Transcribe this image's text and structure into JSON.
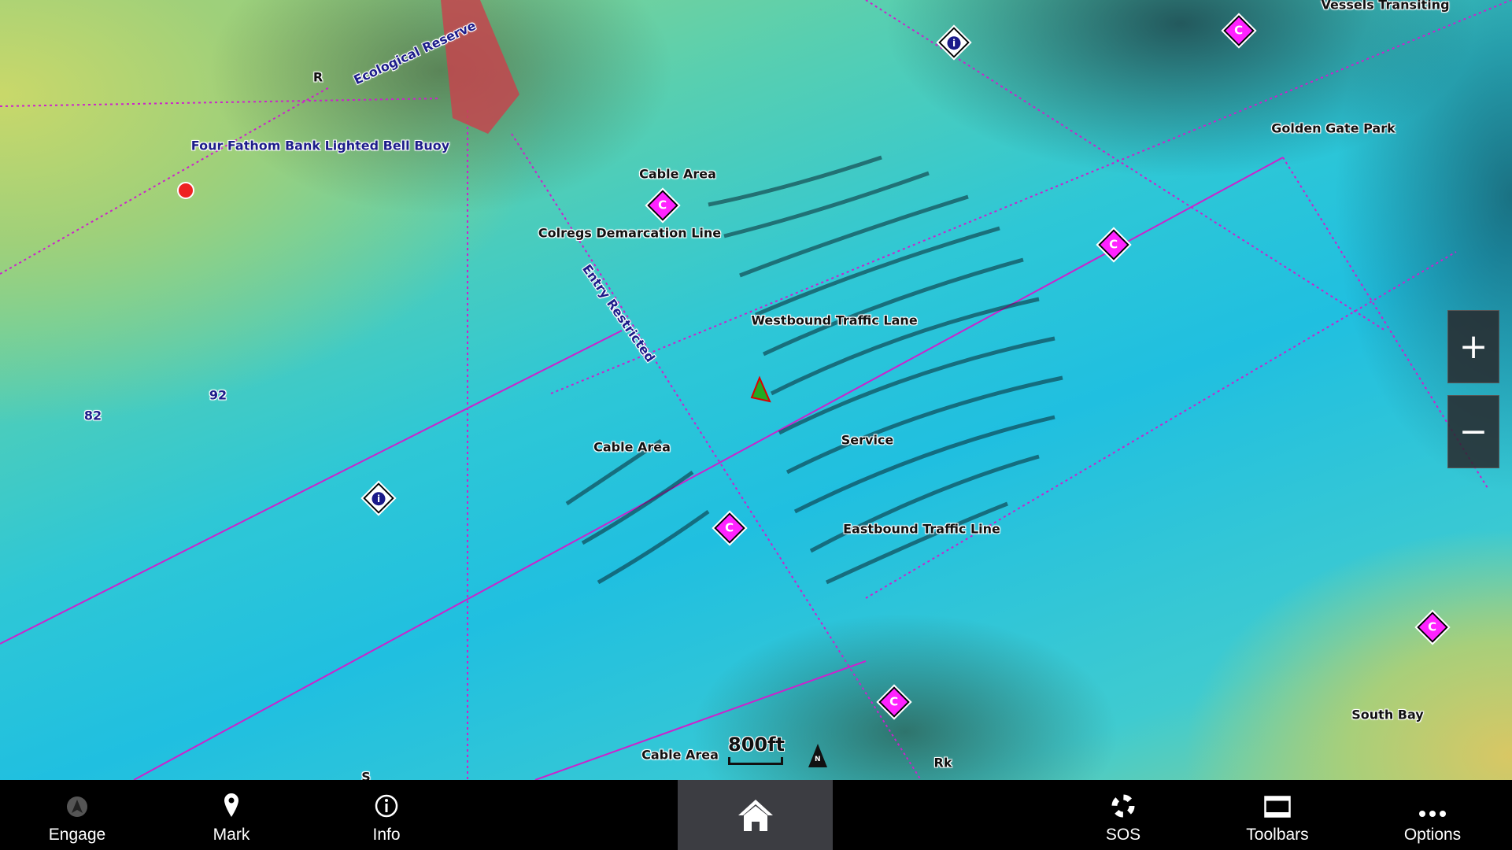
{
  "map": {
    "labels": {
      "ecological_reserve": "Ecological Reserve",
      "r": "R",
      "buoy": "Four Fathom Bank Lighted Bell Buoy",
      "cable_area_1": "Cable Area",
      "colregs": "Colregs Demarcation Line",
      "entry_restricted": "Entry Restricted",
      "westbound": "Westbound Traffic Lane",
      "service": "Service",
      "cable_area_2": "Cable Area",
      "eastbound": "Eastbound Traffic Line",
      "golden_gate_park": "Golden Gate Park",
      "vessels_transiting": "Vessels Transiting",
      "south_bay": "South Bay",
      "cable_area_3": "Cable Area",
      "rk": "Rk",
      "depth_82": "82",
      "depth_92": "92",
      "s": "S"
    },
    "marker_c": "C",
    "marker_i": "i",
    "scale": "800ft",
    "north": "N",
    "zoom_in": "+",
    "zoom_out": "−",
    "colors": {
      "route_line": "#cc22cc",
      "marker": "#ff22ff",
      "highlight": "#3c3d42"
    }
  },
  "bottom_bar": {
    "engage": "Engage",
    "mark": "Mark",
    "info": "Info",
    "sos": "SOS",
    "toolbars": "Toolbars",
    "options": "Options"
  }
}
